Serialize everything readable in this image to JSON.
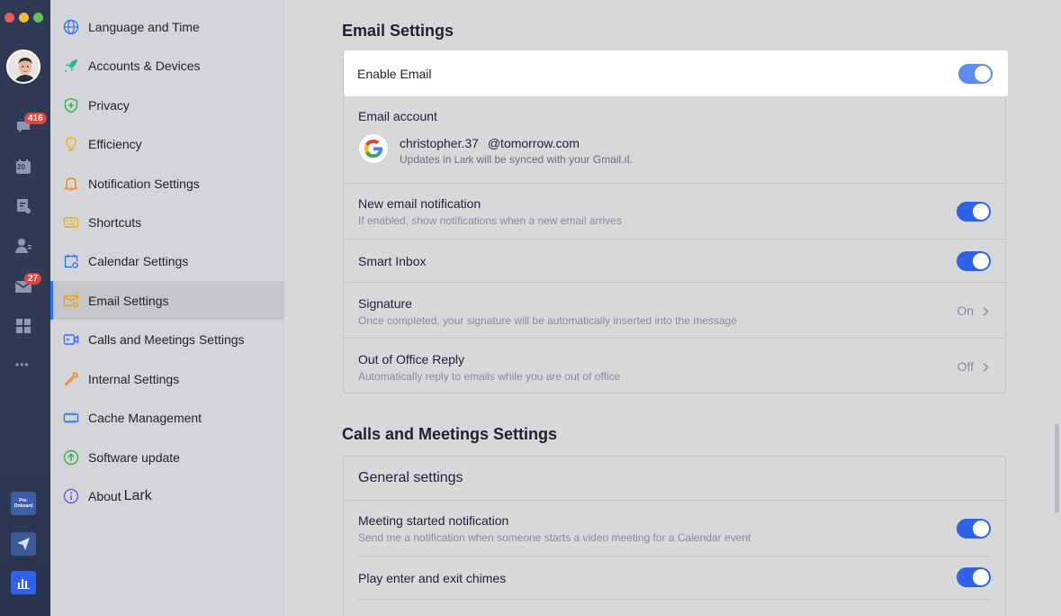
{
  "rail": {
    "chat_badge": "416",
    "calendar_day": "20",
    "mail_badge": "27",
    "more": "•••",
    "onboard_label_1": "Pre-",
    "onboard_label_2": "Onboard"
  },
  "sidebar": {
    "items": [
      {
        "label": "Language and Time",
        "icon": "globe-icon"
      },
      {
        "label": "Accounts & Devices",
        "icon": "rocket-icon"
      },
      {
        "label": "Privacy",
        "icon": "shield-icon"
      },
      {
        "label": "Efficiency",
        "icon": "lightbulb-icon"
      },
      {
        "label": "Notification Settings",
        "icon": "bell-icon"
      },
      {
        "label": "Shortcuts",
        "icon": "keyboard-icon"
      },
      {
        "label": "Calendar Settings",
        "icon": "calendar-gear-icon"
      },
      {
        "label": "Email Settings",
        "icon": "mail-gear-icon"
      },
      {
        "label": "Calls and Meetings Settings",
        "icon": "video-icon"
      },
      {
        "label": "Internal Settings",
        "icon": "wrench-icon"
      },
      {
        "label": "Cache Management",
        "icon": "chip-icon"
      },
      {
        "label": "Software update",
        "icon": "upload-circle-icon"
      },
      {
        "label": "About",
        "label_brand": "Lark",
        "icon": "info-icon"
      }
    ],
    "active_index": 7
  },
  "email": {
    "title": "Email Settings",
    "enable_label": "Enable Email",
    "account_label": "Email account",
    "account_user": "christopher.37",
    "account_domain": "@tomorrow.com",
    "account_note_pre": "Updates in",
    "account_note_brand": "Lark",
    "account_note_post": "will be synced with your Gmail.ıl.",
    "new_notification_title": "New email notification",
    "new_notification_desc": "If enabled, show notifications when a new email arrives",
    "smart_inbox": "Smart Inbox",
    "signature_title": "Signature",
    "signature_desc": "Once completed, your signature will be automatically inserted into the message",
    "signature_value": "On",
    "ooo_title": "Out of Office Reply",
    "ooo_desc": "Automatically reply to emails while you are out of office",
    "ooo_value": "Off"
  },
  "calls": {
    "title": "Calls and Meetings Settings",
    "general": "General settings",
    "meeting_started_title": "Meeting started notification",
    "meeting_started_desc": "Send me a notification when someone starts a video meeting for a Calendar event",
    "chimes": "Play enter and exit chimes"
  },
  "colors": {
    "accent": "#2f62e6",
    "rail": "#2e3a55",
    "badge": "#e2433c"
  }
}
